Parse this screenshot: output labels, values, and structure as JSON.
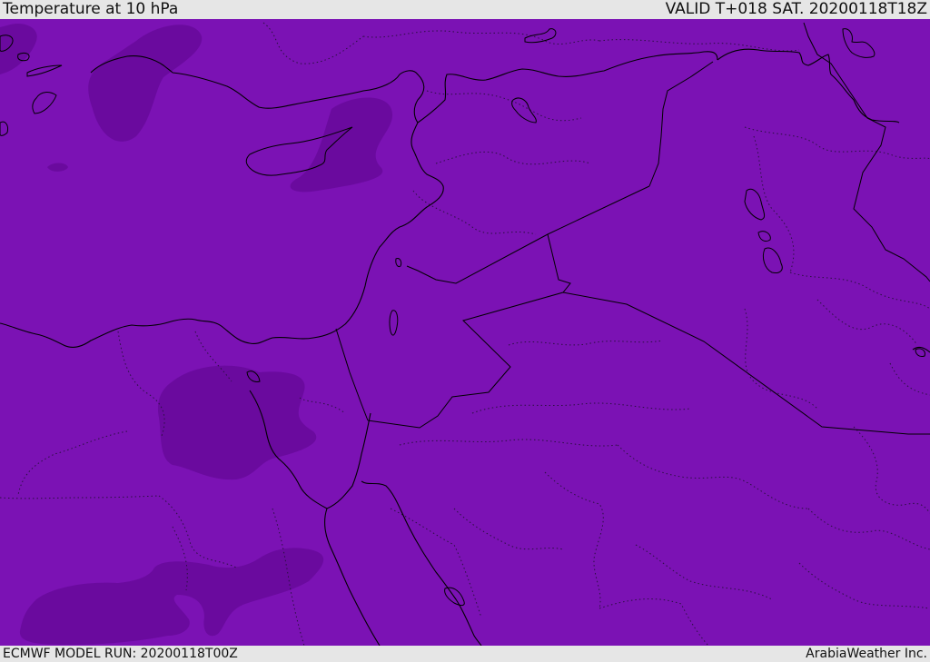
{
  "header": {
    "title": "Temperature at 10 hPa",
    "valid_time": "VALID T+018 SAT. 20200118T18Z"
  },
  "footer": {
    "model_run": "ECMWF MODEL RUN: 20200118T00Z",
    "credit": "ArabiaWeather Inc."
  },
  "map": {
    "region": "Eastern Mediterranean and Middle East",
    "field": "temperature",
    "pressure_level": "10 hPa",
    "colors": {
      "base_fill": "#7b12b4",
      "cold_pocket_fill": "#6a0a9e",
      "coastline": "#000000",
      "border": "#000000",
      "admin_boundary": "#2a1040"
    }
  }
}
